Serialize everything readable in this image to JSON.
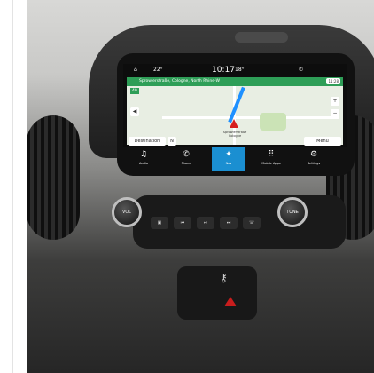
{
  "status_bar": {
    "temp_left": "22°",
    "clock": "10:17",
    "temp_right": "18°"
  },
  "navigation": {
    "street_banner": "Sprowlerstraße, Cologne, North Rhine-W",
    "distance": "40",
    "eta": "11:28",
    "current_location": "Sprowlerstraße\nCologne",
    "destination_label": "Destination",
    "menu_label": "Menu"
  },
  "apps": [
    {
      "icon": "music-note-icon",
      "label": "Audio"
    },
    {
      "icon": "phone-icon",
      "label": "Phone"
    },
    {
      "icon": "navigation-icon",
      "label": "Nav",
      "active": true
    },
    {
      "icon": "grid-icon",
      "label": "Mobile Apps"
    },
    {
      "icon": "settings-icon",
      "label": "Settings"
    }
  ],
  "controls": {
    "vol_label": "VOL",
    "tune_label": "TUNE"
  },
  "colors": {
    "map_green": "#2e9e57",
    "active_blue": "#1b8fd1",
    "hazard_red": "#c81d1d"
  }
}
